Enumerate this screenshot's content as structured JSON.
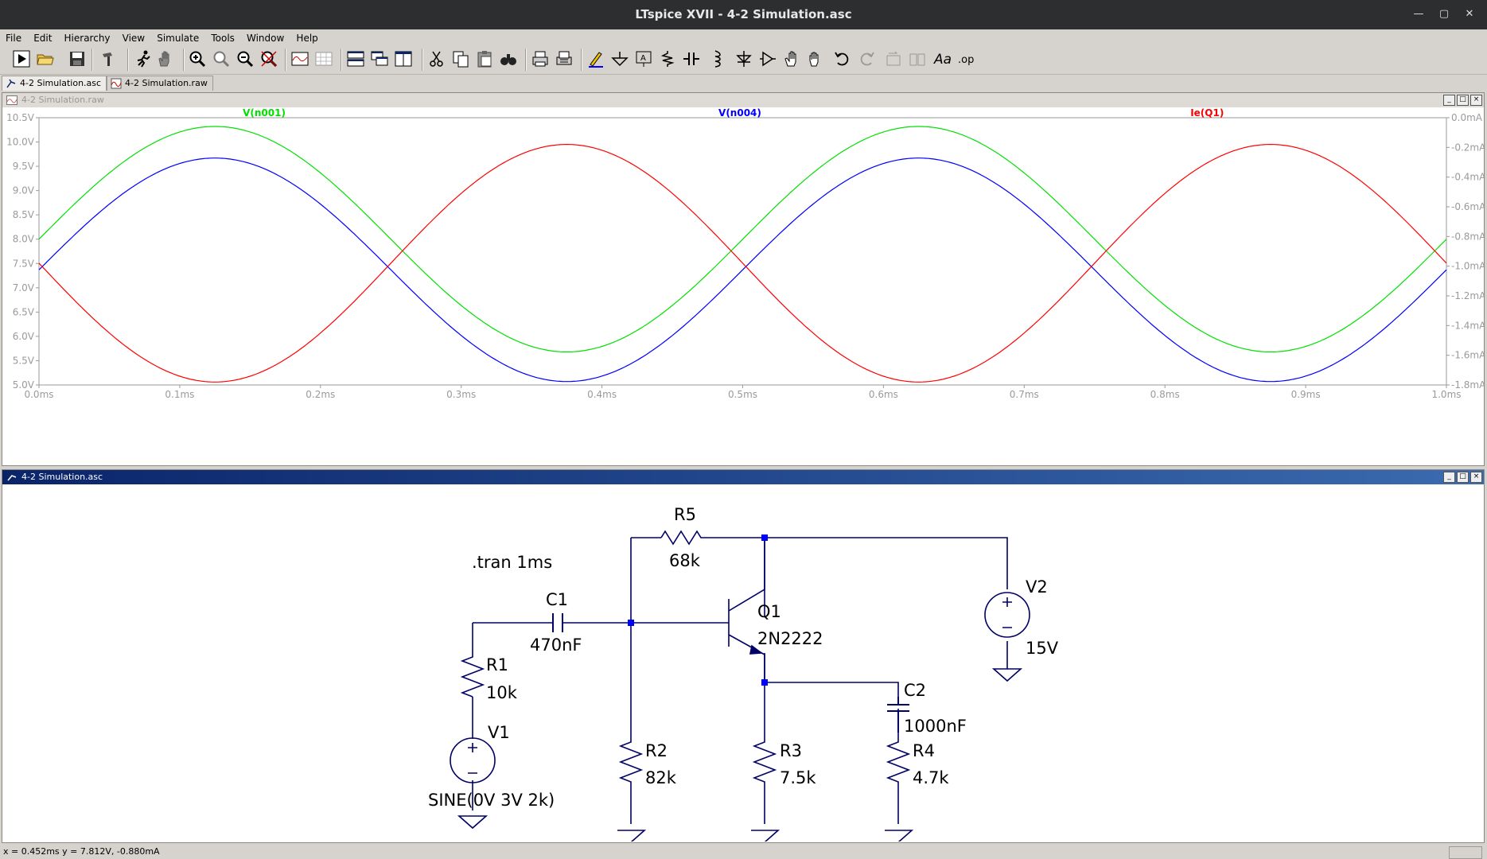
{
  "window": {
    "title": "LTspice XVII - 4-2 Simulation.asc"
  },
  "menu": [
    "File",
    "Edit",
    "Hierarchy",
    "View",
    "Simulate",
    "Tools",
    "Window",
    "Help"
  ],
  "tabs": [
    {
      "label": "4-2 Simulation.asc",
      "icon": "schematic-icon",
      "active": true
    },
    {
      "label": "4-2 Simulation.raw",
      "icon": "waveform-icon",
      "active": false
    }
  ],
  "waveform_window": {
    "title": "4-2 Simulation.raw"
  },
  "schematic_window": {
    "title": "4-2 Simulation.asc"
  },
  "chart_data": {
    "type": "line",
    "title": "",
    "x_ticks": [
      "0.0ms",
      "0.1ms",
      "0.2ms",
      "0.3ms",
      "0.4ms",
      "0.5ms",
      "0.6ms",
      "0.7ms",
      "0.8ms",
      "0.9ms",
      "1.0ms"
    ],
    "xlim_ms": [
      0,
      1
    ],
    "y_left_ticks": [
      "10.5V",
      "10.0V",
      "9.5V",
      "9.0V",
      "8.5V",
      "8.0V",
      "7.5V",
      "7.0V",
      "6.5V",
      "6.0V",
      "5.5V",
      "5.0V"
    ],
    "y_left_lim": [
      5.0,
      10.5
    ],
    "y_right_ticks": [
      "0.0mA",
      "-0.2mA",
      "-0.4mA",
      "-0.6mA",
      "-0.8mA",
      "-1.0mA",
      "-1.2mA",
      "-1.4mA",
      "-1.6mA",
      "-1.8mA"
    ],
    "y_right_lim": [
      -1.8,
      0.0
    ],
    "series": [
      {
        "name": "V(n001)",
        "color": "#00e000",
        "axis": "left",
        "unit": "V",
        "offset": 8.0,
        "amplitude": 2.32,
        "freq_khz": 2
      },
      {
        "name": "V(n004)",
        "color": "#0000ff",
        "axis": "left",
        "unit": "V",
        "offset": 7.37,
        "amplitude": 2.3,
        "freq_khz": 2
      },
      {
        "name": "Ie(Q1)",
        "color": "#ff0000",
        "axis": "right",
        "unit": "mA",
        "offset": -0.98,
        "amplitude": 0.8,
        "freq_khz": 2,
        "inverted": true
      }
    ]
  },
  "schematic": {
    "directive": ".tran 1ms",
    "components": {
      "R5": {
        "name": "R5",
        "value": "68k"
      },
      "C1": {
        "name": "C1",
        "value": "470nF"
      },
      "Q1": {
        "name": "Q1",
        "value": "2N2222"
      },
      "V2": {
        "name": "V2",
        "value": "15V"
      },
      "R1": {
        "name": "R1",
        "value": "10k"
      },
      "V1": {
        "name": "V1",
        "value": "SINE(0V 3V 2k)"
      },
      "R2": {
        "name": "R2",
        "value": "82k"
      },
      "R3": {
        "name": "R3",
        "value": "7.5k"
      },
      "C2": {
        "name": "C2",
        "value": "1000nF"
      },
      "R4": {
        "name": "R4",
        "value": "4.7k"
      }
    }
  },
  "status": {
    "text": "x = 0.452ms    y = 7.812V, -0.880mA"
  }
}
